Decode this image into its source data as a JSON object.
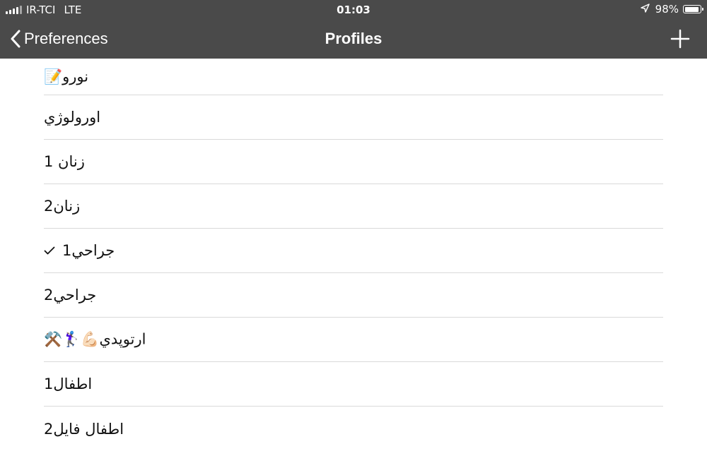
{
  "status_bar": {
    "carrier": "IR-TCI",
    "network": "LTE",
    "time": "01:03",
    "battery": "98%",
    "battery_level": 0.98
  },
  "nav": {
    "back_label": "Preferences",
    "title": "Profiles",
    "add_icon": "plus-icon"
  },
  "profiles": [
    {
      "label": "نورو📝",
      "checked": false
    },
    {
      "label": "اورولوژي",
      "checked": false
    },
    {
      "label": "زنان 1",
      "checked": false
    },
    {
      "label": "زنان2",
      "checked": false
    },
    {
      "label": "جراحي1",
      "checked": true
    },
    {
      "label": "جراحي2",
      "checked": false
    },
    {
      "label": "ارتوپدي💪🏻🏌🏽‍♀️⚒️",
      "checked": false
    },
    {
      "label": "اطفال1",
      "checked": false
    },
    {
      "label": "اطفال فايل2",
      "checked": false
    }
  ],
  "colors": {
    "nav_background": "#4a4a4a",
    "separator": "#d9d9d9"
  }
}
